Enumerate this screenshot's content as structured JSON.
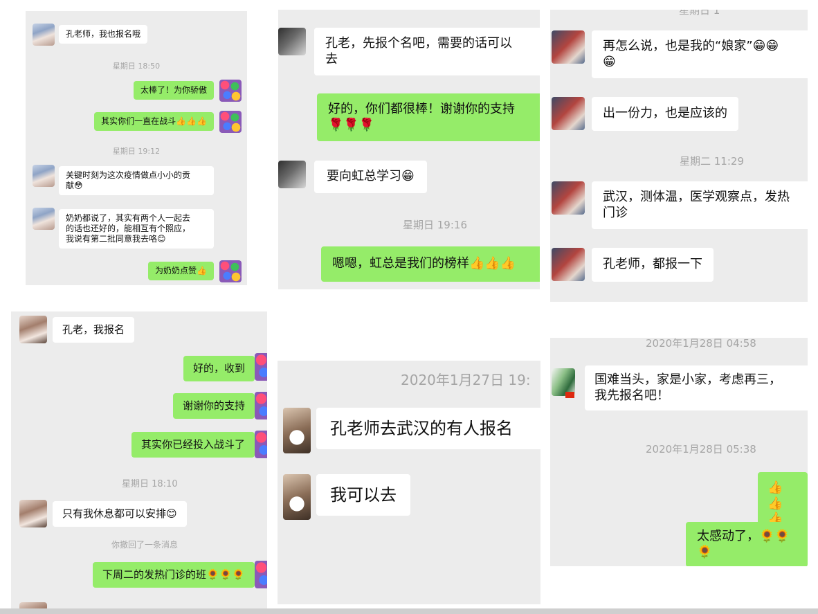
{
  "panel1": {
    "msgs": [
      {
        "text": "孔老师，我也报名哦"
      },
      {
        "text": "星期日 18:50"
      },
      {
        "text": "太棒了！为你骄傲"
      },
      {
        "text": "其实你们一直在战斗👍👍👍"
      },
      {
        "text": "星期日 19:12"
      },
      {
        "text": "关键时刻为这次疫情做点小小的贡\n献😳"
      },
      {
        "text": "奶奶都说了，其实有两个人一起去\n的话也还好的，能相互有个照应，\n我说有第二批同意我去咯😊"
      },
      {
        "text": "为奶奶点赞👍"
      }
    ]
  },
  "panel2": {
    "msgs": [
      {
        "text": "孔老，先报个名吧，需要的话可以\n去"
      },
      {
        "text": "好的，你们都很棒！谢谢你的支持\n🌹🌹🌹"
      },
      {
        "text": "要向虹总学习😁"
      },
      {
        "text": "星期日 19:16"
      },
      {
        "text": "嗯嗯，虹总是我们的榜样👍👍👍"
      }
    ]
  },
  "panel3": {
    "msgs": [
      {
        "text": "星期日 1"
      },
      {
        "text": "再怎么说，也是我的“娘家”😁😁\n😁"
      },
      {
        "text": "出一份力，也是应该的"
      },
      {
        "text": "星期二 11:29"
      },
      {
        "text": "武汉，测体温，医学观察点，发热\n门诊"
      },
      {
        "text": "孔老师，都报一下"
      }
    ]
  },
  "panel4": {
    "msgs": [
      {
        "text": "孔老，我报名"
      },
      {
        "text": "好的，收到"
      },
      {
        "text": "谢谢你的支持"
      },
      {
        "text": "其实你已经投入战斗了"
      },
      {
        "text": "星期日 18:10"
      },
      {
        "text": "只有我休息都可以安排😊"
      },
      {
        "text": "你撤回了一条消息"
      },
      {
        "text": "下周二的发热门诊的班🌻🌻🌻"
      }
    ]
  },
  "panel5": {
    "msgs": [
      {
        "text": "2020年1月27日 19:"
      },
      {
        "text": "孔老师去武汉的有人报名"
      },
      {
        "text": "我可以去"
      }
    ]
  },
  "panel6": {
    "msgs": [
      {
        "text": "2020年1月28日 04:58"
      },
      {
        "text": "国难当头，家是小家，考虑再三，\n我先报名吧！"
      },
      {
        "text": "2020年1月28日 05:38"
      },
      {
        "text": "👍👍👍"
      },
      {
        "text": "太感动了，🌻🌻🌻"
      }
    ]
  }
}
